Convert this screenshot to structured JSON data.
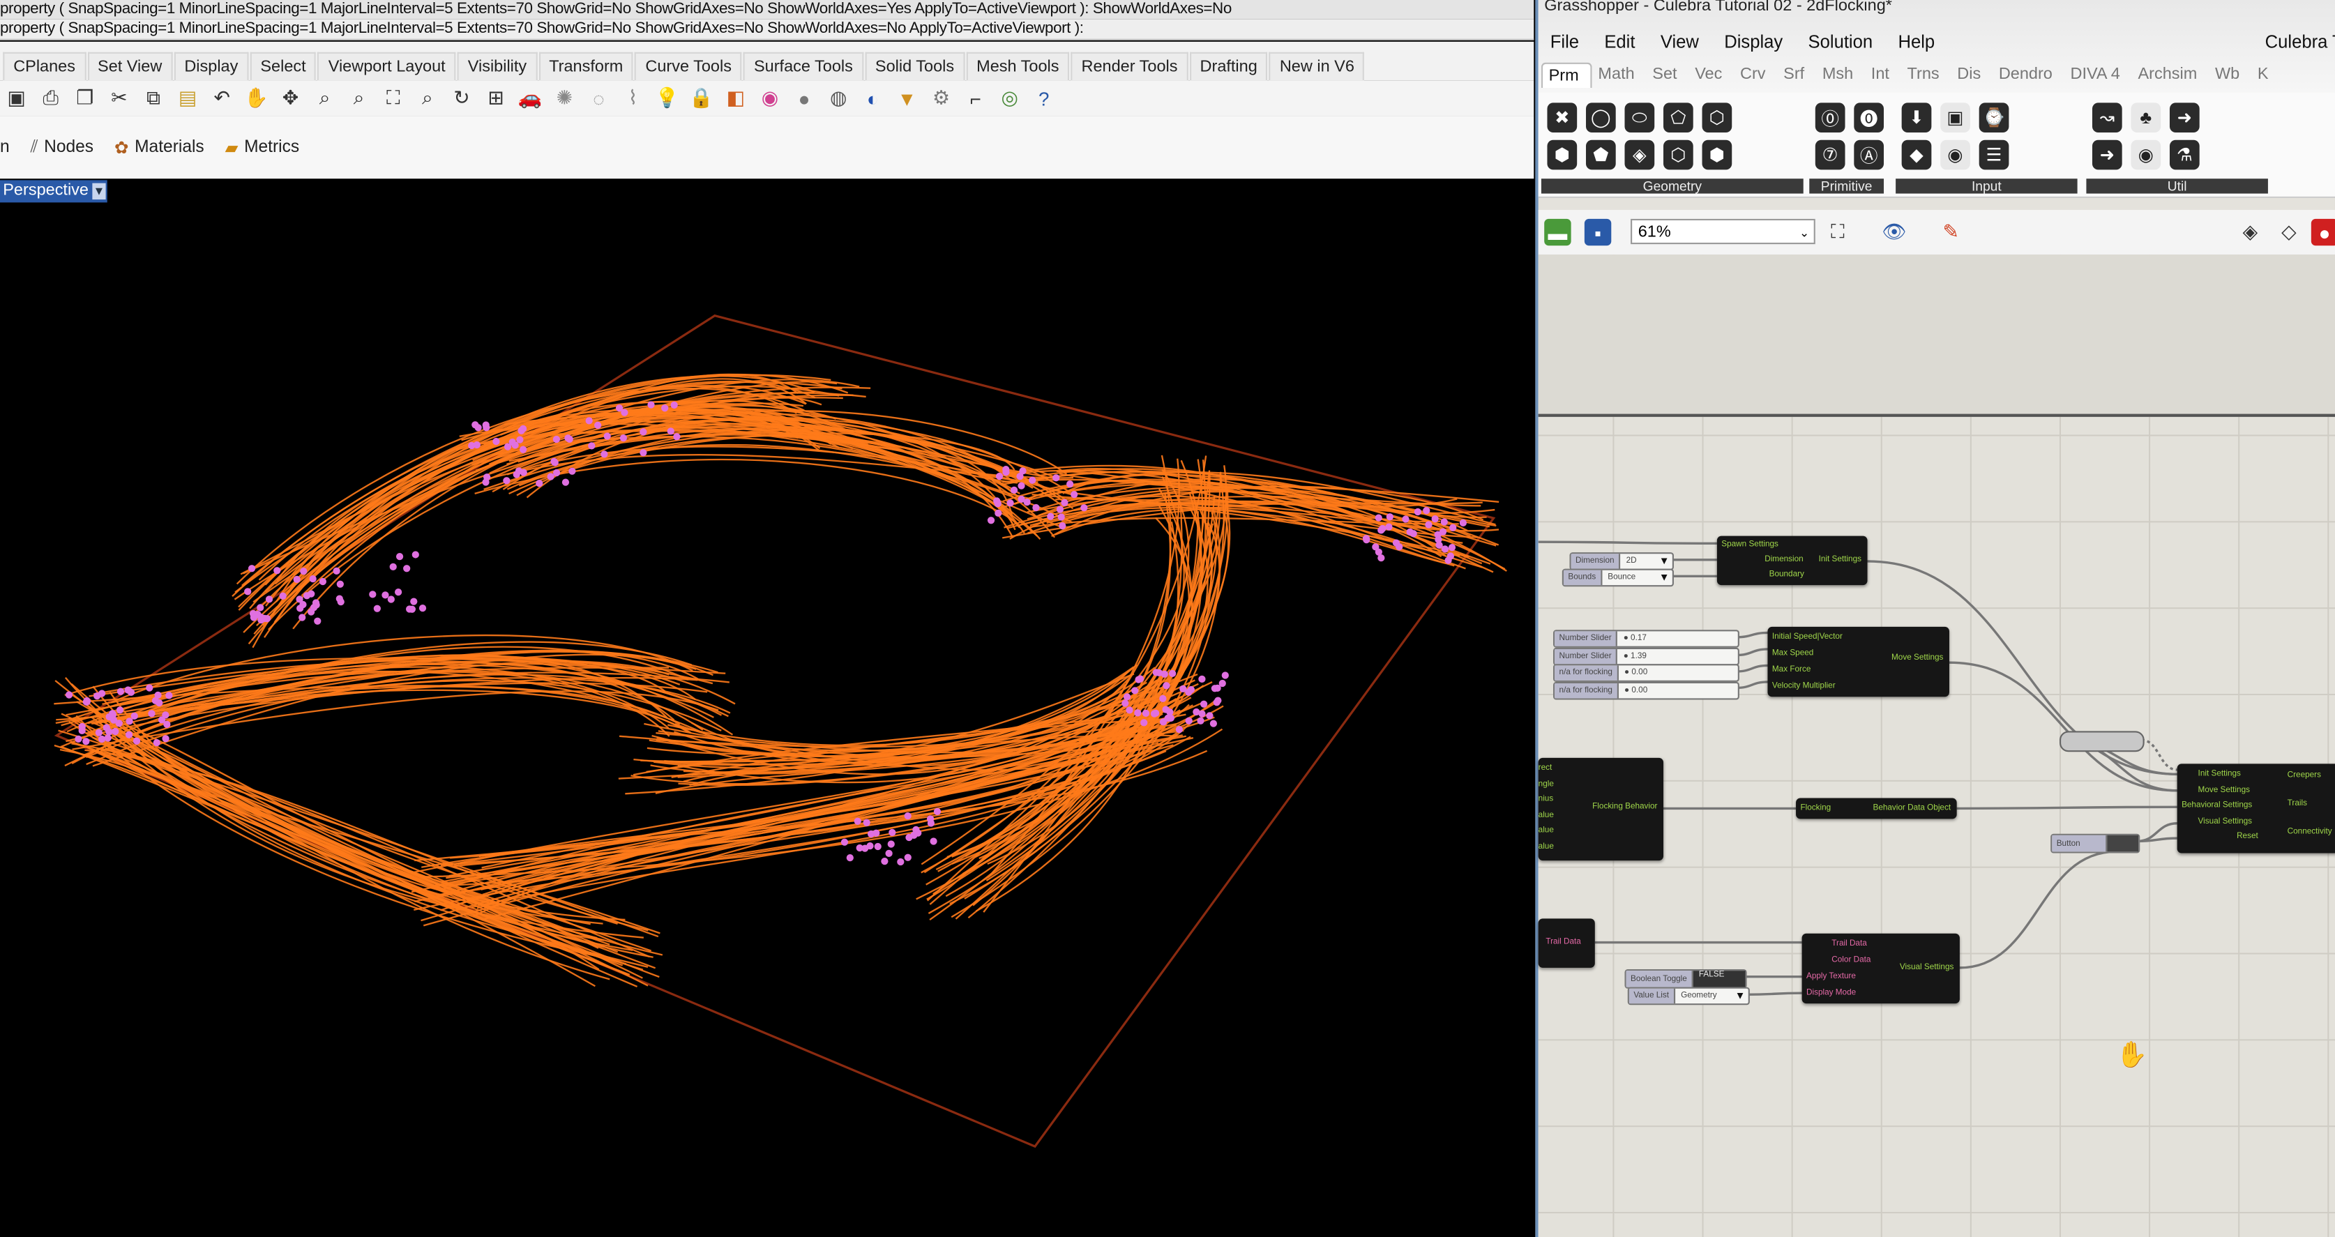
{
  "rhino": {
    "command_history": [
      "property ( SnapSpacing=1  MinorLineSpacing=1  MajorLineInterval=5  Extents=70  ShowGrid=No  ShowGridAxes=No  ShowWorldAxes=Yes  ApplyTo=ActiveViewport ): ShowWorldAxes=No",
      "property ( SnapSpacing=1  MinorLineSpacing=1  MajorLineInterval=5  Extents=70  ShowGrid=No  ShowGridAxes=No  ShowWorldAxes=No  ApplyTo=ActiveViewport ):"
    ],
    "tabs": [
      "CPlanes",
      "Set View",
      "Display",
      "Select",
      "Viewport Layout",
      "Visibility",
      "Transform",
      "Curve Tools",
      "Surface Tools",
      "Solid Tools",
      "Mesh Tools",
      "Render Tools",
      "Drafting",
      "New in V6"
    ],
    "toolbar_icons": [
      "save-icon",
      "print-icon",
      "new-icon",
      "cut-icon",
      "copy-icon",
      "paste-icon",
      "undo-icon",
      "pan-icon",
      "move-icon",
      "zoom-icon",
      "zoom-window-icon",
      "zoom-extents-icon",
      "zoom-selected-icon",
      "rotate-icon",
      "grid-icon",
      "car-icon",
      "light-icon",
      "circle-icon",
      "polyline-icon",
      "bulb-icon",
      "lock-icon",
      "layer-icon",
      "color-wheel-icon",
      "sphere-icon",
      "render-sphere-icon",
      "globe-icon",
      "filter-icon",
      "gear-icon",
      "dimension-icon",
      "world-icon",
      "help-icon"
    ],
    "panel_row": {
      "clipped": "n",
      "nodes": "Nodes",
      "materials": "Materials",
      "metrics": "Metrics"
    },
    "viewport": {
      "name": "Perspective",
      "curve_color": "#ff7a1a",
      "agent_color": "#e070e0",
      "boundary_color": "#8a2a10"
    }
  },
  "grasshopper": {
    "title": "Grasshopper - Culebra Tutorial 02 - 2dFlocking*",
    "menu": [
      "File",
      "Edit",
      "View",
      "Display",
      "Solution",
      "Help"
    ],
    "document_name": "Culebra Tu",
    "tabs": [
      "Prm",
      "Math",
      "Set",
      "Vec",
      "Crv",
      "Srf",
      "Msh",
      "Int",
      "Trns",
      "Dis",
      "Dendro",
      "DIVA 4",
      "Archsim",
      "Wb",
      "K"
    ],
    "active_tab": "Prm",
    "groups": [
      "Geometry",
      "Primitive",
      "Input",
      "Util"
    ],
    "zoom": "61%",
    "nodes": {
      "dimension_list": {
        "label": "Dimension",
        "value": "2D"
      },
      "bounds_list": {
        "label": "Bounds",
        "value": "Bounce"
      },
      "spawn": {
        "inputs": [
          "Spawn Settings",
          "Dimension",
          "Boundary"
        ],
        "output": "Init Settings"
      },
      "sliders": [
        {
          "label": "Number Slider",
          "value": "0.17"
        },
        {
          "label": "Number Slider",
          "value": "1.39"
        },
        {
          "label": "n/a for flocking",
          "value": "0.00"
        },
        {
          "label": "n/a for flocking",
          "value": "0.00"
        }
      ],
      "move": {
        "inputs": [
          "Initial Speed|Vector",
          "Max Speed",
          "Max Force",
          "Velocity Multiplier"
        ],
        "output": "Move Settings"
      },
      "flocking": {
        "inputs": [
          "rect",
          "ngle",
          "nius",
          "alue",
          "alue",
          "alue"
        ],
        "output": "Flocking Behavior"
      },
      "behavior_data": {
        "input": "Flocking",
        "output": "Behavior Data Object"
      },
      "creeper": {
        "inputs": [
          "Init Settings",
          "Move Settings",
          "Behavioral Settings",
          "Visual Settings",
          "Reset"
        ],
        "outputs": [
          "Creepers",
          "Trails",
          "Connectivity"
        ]
      },
      "button": {
        "label": "Button"
      },
      "trail": {
        "output": "Trail Data"
      },
      "visual": {
        "inputs": [
          "Trail Data",
          "Color Data",
          "Apply Texture",
          "Display Mode"
        ],
        "output": "Visual Settings"
      },
      "toggle": {
        "label": "Boolean Toggle",
        "value": "FALSE"
      },
      "value_list": {
        "label": "Value List",
        "value": "Geometry"
      }
    }
  }
}
